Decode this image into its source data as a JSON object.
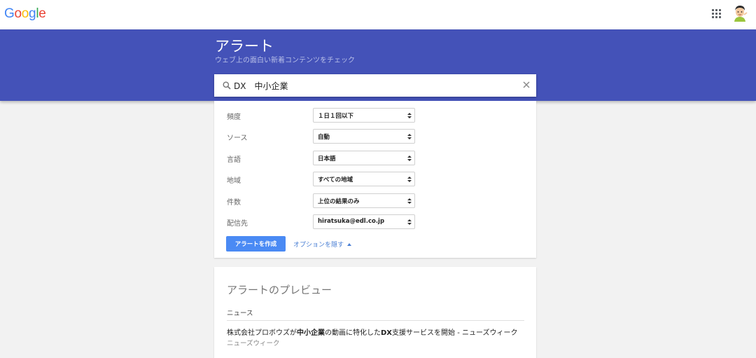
{
  "header": {
    "logo_letters": [
      {
        "char": "G",
        "color": "#4285F4"
      },
      {
        "char": "o",
        "color": "#EA4335"
      },
      {
        "char": "o",
        "color": "#FBBC05"
      },
      {
        "char": "g",
        "color": "#4285F4"
      },
      {
        "char": "l",
        "color": "#34A853"
      },
      {
        "char": "e",
        "color": "#EA4335"
      }
    ],
    "apps_icon": "grid-icon",
    "avatar_icon": "user-avatar"
  },
  "banner": {
    "title": "アラート",
    "subtitle": "ウェブ上の面白い新着コンテンツをチェック",
    "color": "#4452b8"
  },
  "search": {
    "value": "DX　中小企業"
  },
  "options": [
    {
      "name": "frequency",
      "label": "頻度",
      "value": "１日１回以下"
    },
    {
      "name": "source",
      "label": "ソース",
      "value": "自動"
    },
    {
      "name": "language",
      "label": "言語",
      "value": "日本語"
    },
    {
      "name": "region",
      "label": "地域",
      "value": "すべての地域"
    },
    {
      "name": "count",
      "label": "件数",
      "value": "上位の結果のみ"
    },
    {
      "name": "deliver-to",
      "label": "配信先",
      "value": "hiratsuka@edl.co.jp"
    }
  ],
  "actions": {
    "create_label": "アラートを作成",
    "hide_options_label": "オプションを隠す",
    "accent": "#4a8af4"
  },
  "preview": {
    "title": "アラートのプレビュー",
    "section": "ニュース",
    "item": {
      "before": "株式会社プロボウズが",
      "bold1": "中小企業",
      "middle": "の動画に特化した",
      "bold2": "DX",
      "after": "支援サービスを開始 - ニューズウィーク",
      "source": "ニューズウィーク"
    }
  }
}
